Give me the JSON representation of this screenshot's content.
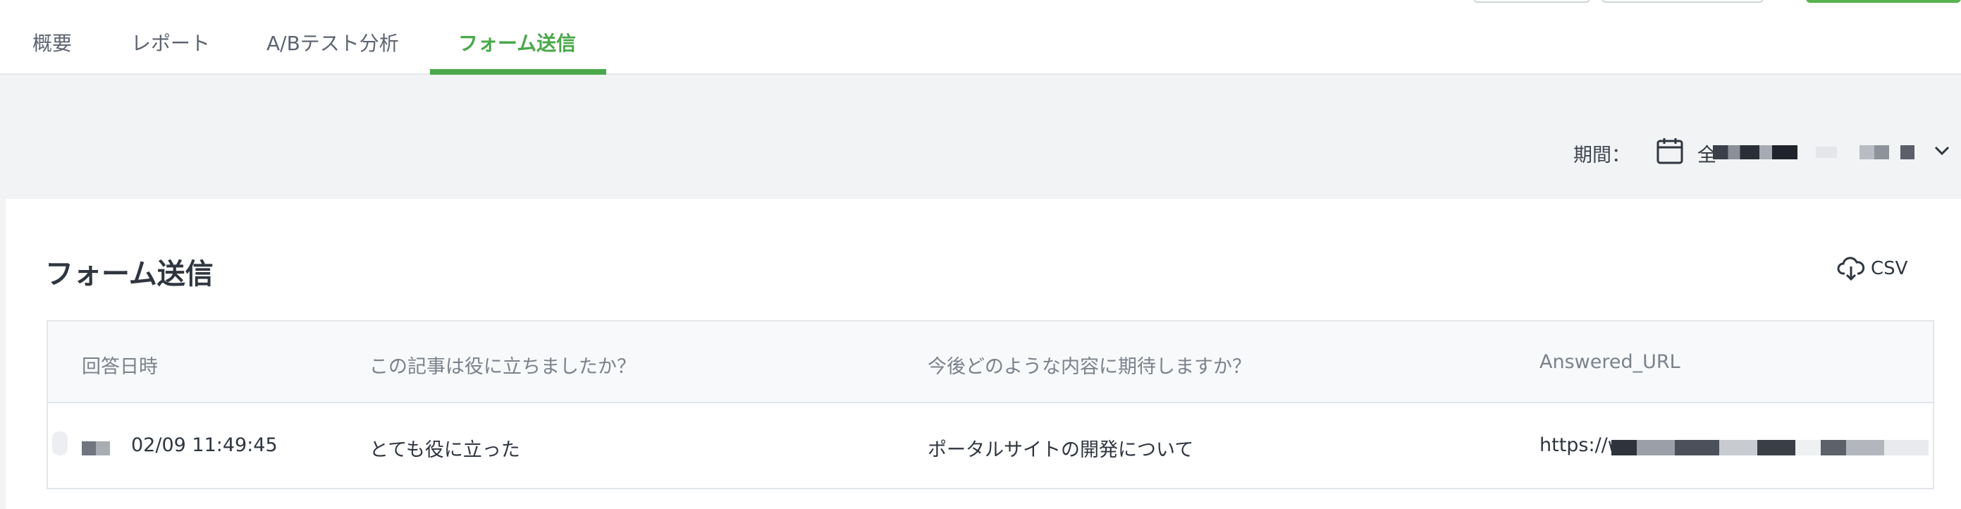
{
  "tabs": [
    {
      "label": "概要",
      "active": false
    },
    {
      "label": "レポート",
      "active": false
    },
    {
      "label": "A/Bテスト分析",
      "active": false
    },
    {
      "label": "フォーム送信",
      "active": true
    }
  ],
  "filter": {
    "period_label": "期間：",
    "period_value_visible": "全",
    "icon": "calendar-icon",
    "dropdown_icon": "chevron-down-icon"
  },
  "card": {
    "title": "フォーム送信",
    "csv_label": "CSV",
    "csv_icon": "cloud-download-icon"
  },
  "table": {
    "columns": [
      "回答日時",
      "この記事は役に立ちましたか？",
      "今後どのような内容に期待しますか？",
      "Answered_URL"
    ],
    "rows": [
      {
        "date_visible": "02/09 11:49:45",
        "helpful": "とても役に立った",
        "expectation": "ポータルサイトの開発について",
        "url_visible": "https://w"
      }
    ]
  },
  "colors": {
    "accent": "#4aa84a",
    "background": "#f2f3f4",
    "text": "#2f3640"
  }
}
